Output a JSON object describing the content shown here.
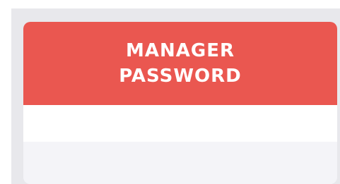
{
  "card": {
    "title": "MANAGER\nPASSWORD"
  },
  "colors": {
    "header": "#ea5750",
    "backdrop": "#e8e8ec",
    "field": "#ffffff",
    "card_body": "#f4f4f8"
  }
}
